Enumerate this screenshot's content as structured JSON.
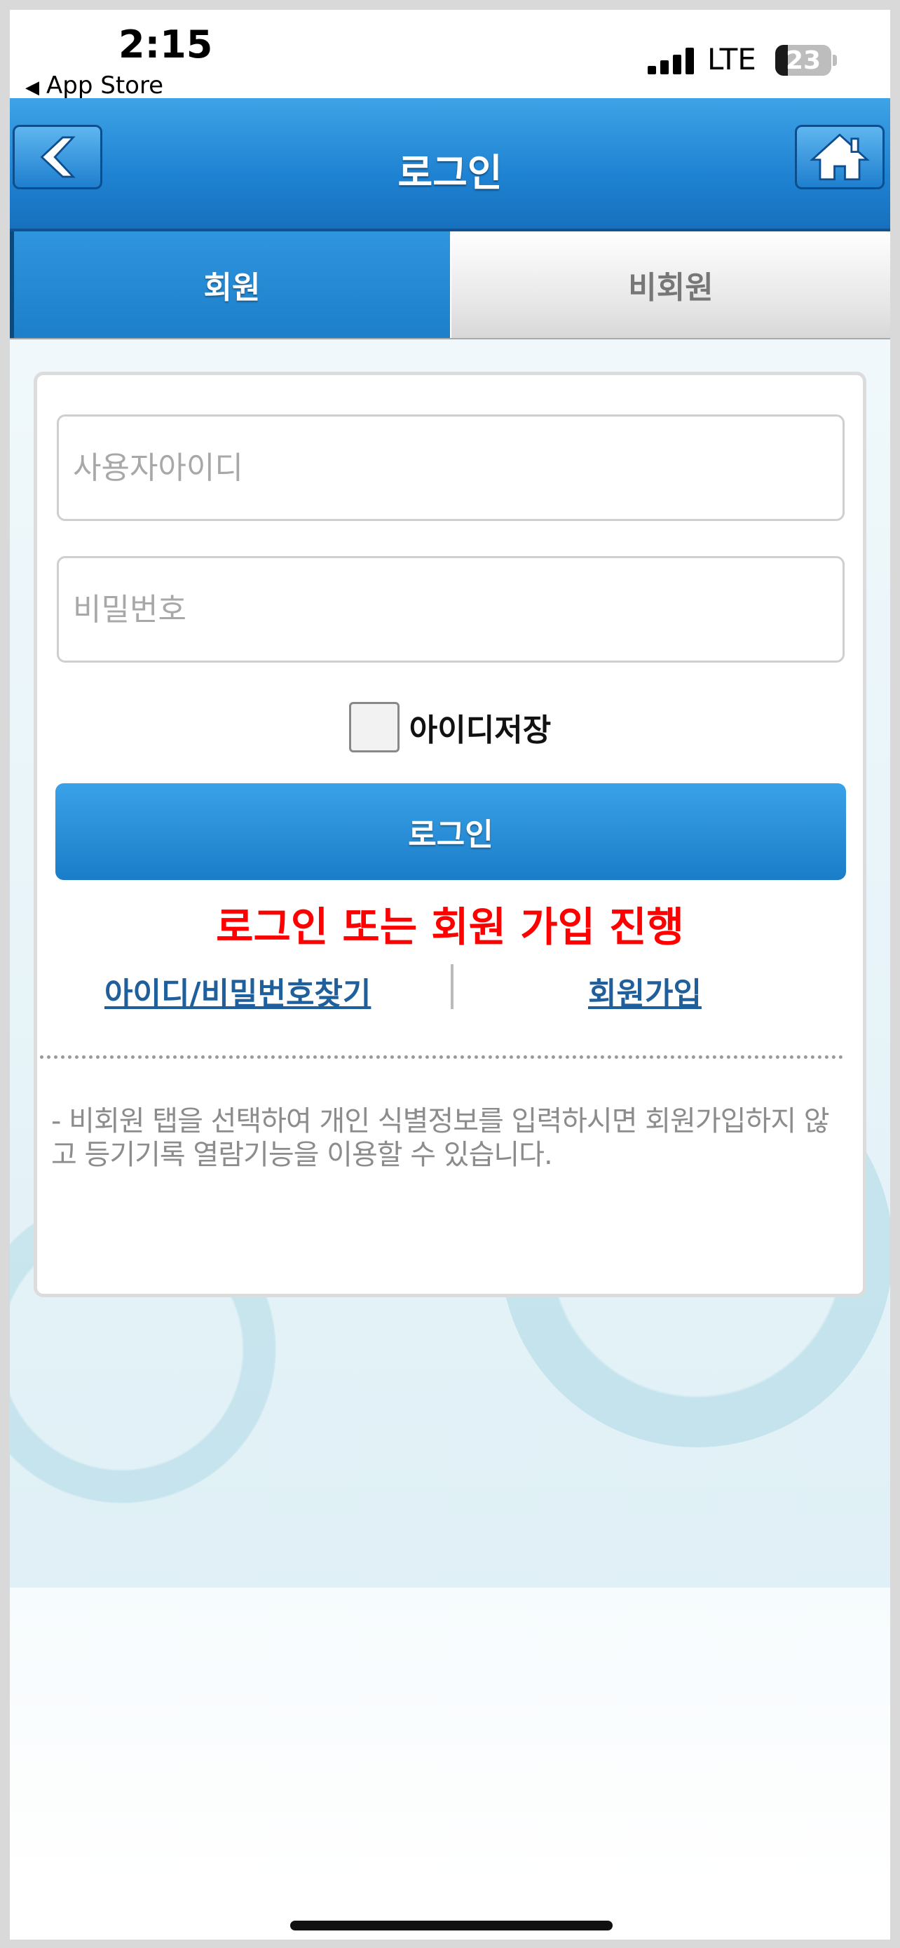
{
  "status_bar": {
    "time": "2:15",
    "back_app": "App Store",
    "network": "LTE",
    "battery": "23",
    "battery_level": 0.23
  },
  "header": {
    "title": "로그인",
    "back_icon": "chevron-left-icon",
    "home_icon": "home-icon",
    "color_accent": "#1e82d2"
  },
  "tabs": [
    {
      "label": "회원",
      "active": true
    },
    {
      "label": "비회원",
      "active": false
    }
  ],
  "form": {
    "id_placeholder": "사용자아이디",
    "id_value": "",
    "pw_placeholder": "비밀번호",
    "pw_value": "",
    "save_id_label": "아이디저장",
    "save_id_checked": false,
    "login_button": "로그인"
  },
  "notice": {
    "text": "로그인 또는 회원 가입 진행",
    "color": "#ff0000"
  },
  "links": {
    "find": "아이디/비밀번호찾기",
    "join": "회원가입"
  },
  "info_text": "- 비회원 탭을 선택하여 개인 식별정보를 입력하시면 회원가입하지 않고 등기기록 열람기능을 이용할 수 있습니다."
}
